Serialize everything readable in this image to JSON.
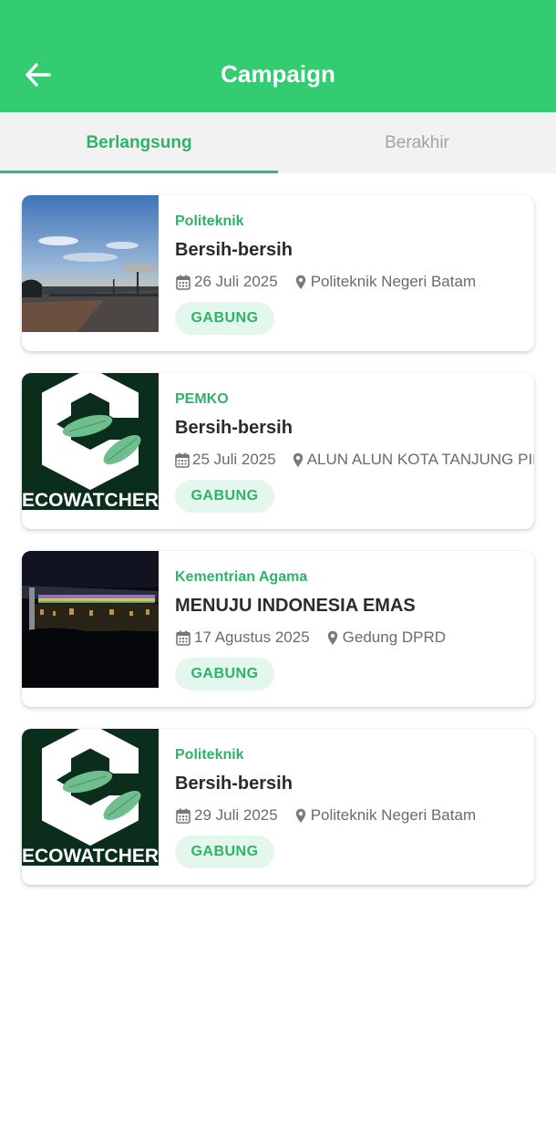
{
  "appbar": {
    "title": "Campaign",
    "back_icon": "arrow-left-icon"
  },
  "tabs": [
    {
      "label": "Berlangsung",
      "active": true
    },
    {
      "label": "Berakhir",
      "active": false
    }
  ],
  "campaigns": [
    {
      "category": "Politeknik",
      "title": "Bersih-bersih",
      "date": "26 Juli 2025",
      "location": "Politeknik Negeri Batam",
      "join_label": "GABUNG",
      "image": "sunset-landscape-photo"
    },
    {
      "category": "PEMKO",
      "title": "Bersih-bersih",
      "date": "25 Juli 2025",
      "location": "ALUN ALUN KOTA TANJUNG PINANG",
      "join_label": "GABUNG",
      "image": "ecowatcher-logo"
    },
    {
      "category": "Kementrian Agama",
      "title": "MENUJU INDONESIA EMAS",
      "date": "17 Agustus 2025",
      "location": "Gedung DPRD",
      "join_label": "GABUNG",
      "image": "night-building-photo"
    },
    {
      "category": "Politeknik",
      "title": "Bersih-bersih",
      "date": "29 Juli 2025",
      "location": "Politeknik Negeri Batam",
      "join_label": "GABUNG",
      "image": "ecowatcher-logo"
    }
  ],
  "logo_text": "ECOWATCHER",
  "colors": {
    "primary": "#33cc71",
    "accent_text": "#2db36b",
    "button_bg": "#e3f7ec",
    "logo_bg": "#0b2d1c"
  }
}
